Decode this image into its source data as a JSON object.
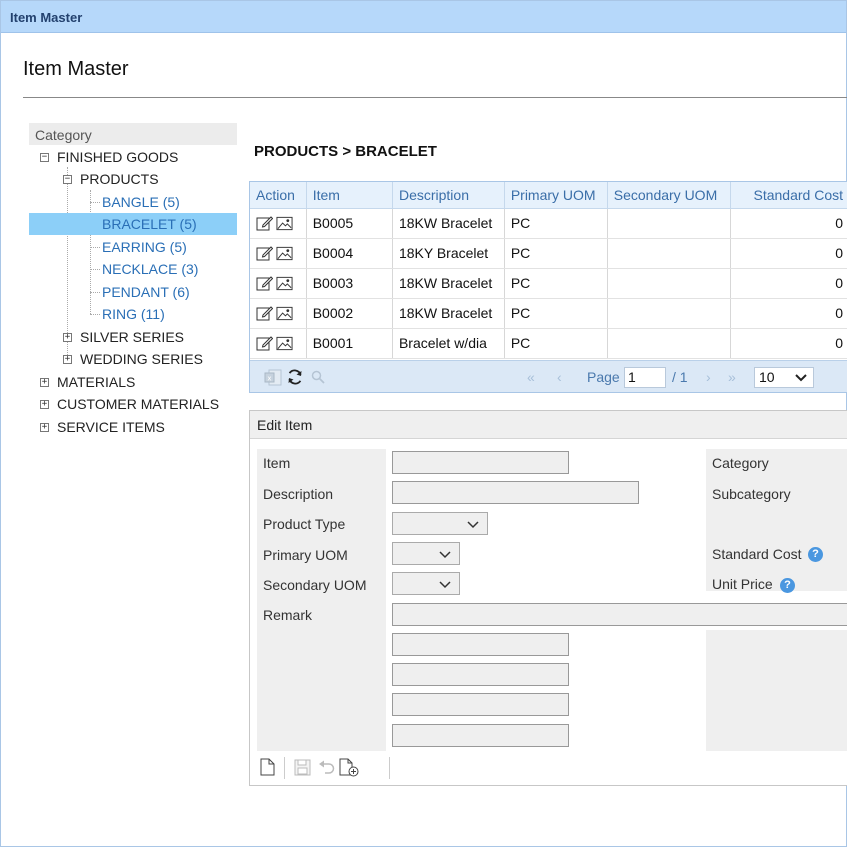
{
  "window": {
    "title": "Item Master"
  },
  "page": {
    "title": "Item Master"
  },
  "tree": {
    "header": "Category",
    "nodes": [
      {
        "label": "FINISHED GOODS",
        "state": "expanded"
      },
      {
        "label": "PRODUCTS",
        "state": "expanded"
      },
      {
        "label": "BANGLE (5)"
      },
      {
        "label": "BRACELET (5)",
        "selected": true
      },
      {
        "label": "EARRING (5)"
      },
      {
        "label": "NECKLACE (3)"
      },
      {
        "label": "PENDANT (6)"
      },
      {
        "label": "RING (11)"
      },
      {
        "label": "SILVER SERIES",
        "state": "collapsed"
      },
      {
        "label": "WEDDING SERIES",
        "state": "collapsed"
      },
      {
        "label": "MATERIALS",
        "state": "collapsed"
      },
      {
        "label": "CUSTOMER MATERIALS",
        "state": "collapsed"
      },
      {
        "label": "SERVICE ITEMS",
        "state": "collapsed"
      }
    ]
  },
  "breadcrumb": "PRODUCTS > BRACELET",
  "grid": {
    "columns": [
      "Action",
      "Item",
      "Description",
      "Primary UOM",
      "Secondary UOM",
      "Standard Cost"
    ],
    "rows": [
      {
        "item": "B0005",
        "description": "18KW Bracelet",
        "primary_uom": "PC",
        "secondary_uom": "",
        "standard_cost": "0"
      },
      {
        "item": "B0004",
        "description": "18KY Bracelet",
        "primary_uom": "PC",
        "secondary_uom": "",
        "standard_cost": "0"
      },
      {
        "item": "B0003",
        "description": "18KW Bracelet",
        "primary_uom": "PC",
        "secondary_uom": "",
        "standard_cost": "0"
      },
      {
        "item": "B0002",
        "description": "18KW Bracelet",
        "primary_uom": "PC",
        "secondary_uom": "",
        "standard_cost": "0"
      },
      {
        "item": "B0001",
        "description": "Bracelet w/dia",
        "primary_uom": "PC",
        "secondary_uom": "",
        "standard_cost": "0"
      }
    ],
    "pager": {
      "page_label": "Page",
      "page_value": "1",
      "total": "/ 1",
      "page_size": "10"
    }
  },
  "edit": {
    "header": "Edit Item",
    "labels": {
      "item": "Item",
      "description": "Description",
      "product_type": "Product Type",
      "primary_uom": "Primary UOM",
      "secondary_uom": "Secondary UOM",
      "remark": "Remark",
      "category": "Category",
      "subcategory": "Subcategory",
      "standard_cost": "Standard Cost",
      "unit_price": "Unit Price"
    },
    "help_glyph": "?"
  },
  "colors": {
    "titlebar": "#b6d8fa",
    "selected_row": "#8ccff8",
    "link": "#2a6fb6",
    "grid_header_text": "#3a6ea8"
  }
}
